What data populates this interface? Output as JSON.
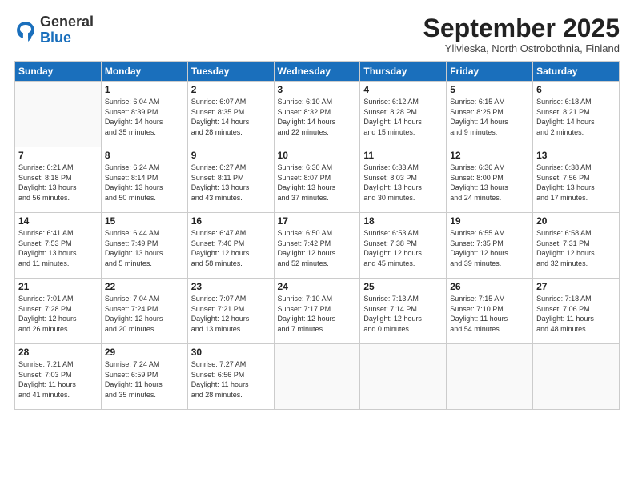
{
  "header": {
    "logo_general": "General",
    "logo_blue": "Blue",
    "month_title": "September 2025",
    "subtitle": "Ylivieska, North Ostrobothnia, Finland"
  },
  "weekdays": [
    "Sunday",
    "Monday",
    "Tuesday",
    "Wednesday",
    "Thursday",
    "Friday",
    "Saturday"
  ],
  "weeks": [
    [
      {
        "day": "",
        "info": ""
      },
      {
        "day": "1",
        "info": "Sunrise: 6:04 AM\nSunset: 8:39 PM\nDaylight: 14 hours\nand 35 minutes."
      },
      {
        "day": "2",
        "info": "Sunrise: 6:07 AM\nSunset: 8:35 PM\nDaylight: 14 hours\nand 28 minutes."
      },
      {
        "day": "3",
        "info": "Sunrise: 6:10 AM\nSunset: 8:32 PM\nDaylight: 14 hours\nand 22 minutes."
      },
      {
        "day": "4",
        "info": "Sunrise: 6:12 AM\nSunset: 8:28 PM\nDaylight: 14 hours\nand 15 minutes."
      },
      {
        "day": "5",
        "info": "Sunrise: 6:15 AM\nSunset: 8:25 PM\nDaylight: 14 hours\nand 9 minutes."
      },
      {
        "day": "6",
        "info": "Sunrise: 6:18 AM\nSunset: 8:21 PM\nDaylight: 14 hours\nand 2 minutes."
      }
    ],
    [
      {
        "day": "7",
        "info": "Sunrise: 6:21 AM\nSunset: 8:18 PM\nDaylight: 13 hours\nand 56 minutes."
      },
      {
        "day": "8",
        "info": "Sunrise: 6:24 AM\nSunset: 8:14 PM\nDaylight: 13 hours\nand 50 minutes."
      },
      {
        "day": "9",
        "info": "Sunrise: 6:27 AM\nSunset: 8:11 PM\nDaylight: 13 hours\nand 43 minutes."
      },
      {
        "day": "10",
        "info": "Sunrise: 6:30 AM\nSunset: 8:07 PM\nDaylight: 13 hours\nand 37 minutes."
      },
      {
        "day": "11",
        "info": "Sunrise: 6:33 AM\nSunset: 8:03 PM\nDaylight: 13 hours\nand 30 minutes."
      },
      {
        "day": "12",
        "info": "Sunrise: 6:36 AM\nSunset: 8:00 PM\nDaylight: 13 hours\nand 24 minutes."
      },
      {
        "day": "13",
        "info": "Sunrise: 6:38 AM\nSunset: 7:56 PM\nDaylight: 13 hours\nand 17 minutes."
      }
    ],
    [
      {
        "day": "14",
        "info": "Sunrise: 6:41 AM\nSunset: 7:53 PM\nDaylight: 13 hours\nand 11 minutes."
      },
      {
        "day": "15",
        "info": "Sunrise: 6:44 AM\nSunset: 7:49 PM\nDaylight: 13 hours\nand 5 minutes."
      },
      {
        "day": "16",
        "info": "Sunrise: 6:47 AM\nSunset: 7:46 PM\nDaylight: 12 hours\nand 58 minutes."
      },
      {
        "day": "17",
        "info": "Sunrise: 6:50 AM\nSunset: 7:42 PM\nDaylight: 12 hours\nand 52 minutes."
      },
      {
        "day": "18",
        "info": "Sunrise: 6:53 AM\nSunset: 7:38 PM\nDaylight: 12 hours\nand 45 minutes."
      },
      {
        "day": "19",
        "info": "Sunrise: 6:55 AM\nSunset: 7:35 PM\nDaylight: 12 hours\nand 39 minutes."
      },
      {
        "day": "20",
        "info": "Sunrise: 6:58 AM\nSunset: 7:31 PM\nDaylight: 12 hours\nand 32 minutes."
      }
    ],
    [
      {
        "day": "21",
        "info": "Sunrise: 7:01 AM\nSunset: 7:28 PM\nDaylight: 12 hours\nand 26 minutes."
      },
      {
        "day": "22",
        "info": "Sunrise: 7:04 AM\nSunset: 7:24 PM\nDaylight: 12 hours\nand 20 minutes."
      },
      {
        "day": "23",
        "info": "Sunrise: 7:07 AM\nSunset: 7:21 PM\nDaylight: 12 hours\nand 13 minutes."
      },
      {
        "day": "24",
        "info": "Sunrise: 7:10 AM\nSunset: 7:17 PM\nDaylight: 12 hours\nand 7 minutes."
      },
      {
        "day": "25",
        "info": "Sunrise: 7:13 AM\nSunset: 7:14 PM\nDaylight: 12 hours\nand 0 minutes."
      },
      {
        "day": "26",
        "info": "Sunrise: 7:15 AM\nSunset: 7:10 PM\nDaylight: 11 hours\nand 54 minutes."
      },
      {
        "day": "27",
        "info": "Sunrise: 7:18 AM\nSunset: 7:06 PM\nDaylight: 11 hours\nand 48 minutes."
      }
    ],
    [
      {
        "day": "28",
        "info": "Sunrise: 7:21 AM\nSunset: 7:03 PM\nDaylight: 11 hours\nand 41 minutes."
      },
      {
        "day": "29",
        "info": "Sunrise: 7:24 AM\nSunset: 6:59 PM\nDaylight: 11 hours\nand 35 minutes."
      },
      {
        "day": "30",
        "info": "Sunrise: 7:27 AM\nSunset: 6:56 PM\nDaylight: 11 hours\nand 28 minutes."
      },
      {
        "day": "",
        "info": ""
      },
      {
        "day": "",
        "info": ""
      },
      {
        "day": "",
        "info": ""
      },
      {
        "day": "",
        "info": ""
      }
    ]
  ]
}
